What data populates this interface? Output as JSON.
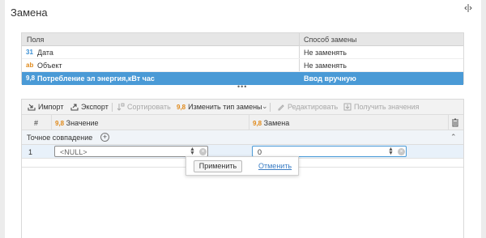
{
  "window": {
    "title": "Замена"
  },
  "fields_table": {
    "columns": [
      "Поля",
      "Способ замены"
    ],
    "rows": [
      {
        "icon": "31",
        "type_icon": "date-icon",
        "name": "Дата",
        "method": "Не заменять",
        "selected": false
      },
      {
        "icon": "ab",
        "type_icon": "text-icon",
        "name": "Объект",
        "method": "Не заменять",
        "selected": false
      },
      {
        "icon": "9,8",
        "type_icon": "number-icon",
        "name": "Потребление эл энергия,кВт час",
        "method": "Ввод вручную",
        "selected": true
      }
    ],
    "more_indicator": "•••"
  },
  "toolbar": {
    "import": "Импорт",
    "export": "Экспорт",
    "sort": "Сортировать",
    "change_type": "Изменить тип замены",
    "change_type_icon": "9,8",
    "edit": "Редактировать",
    "get_values": "Получить значения"
  },
  "grid": {
    "col_num": "#",
    "col_value": "Значение",
    "col_replace": "Замена",
    "col_icon": "9,8",
    "group_label": "Точное совпадение",
    "rows": [
      {
        "num": "1",
        "value": "<NULL>",
        "replacement": "0"
      }
    ]
  },
  "popup": {
    "apply": "Применить",
    "cancel": "Отменить"
  },
  "colors": {
    "selection": "#4a9ad6",
    "accent_orange": "#e08a1b",
    "link": "#3b7dc4"
  }
}
